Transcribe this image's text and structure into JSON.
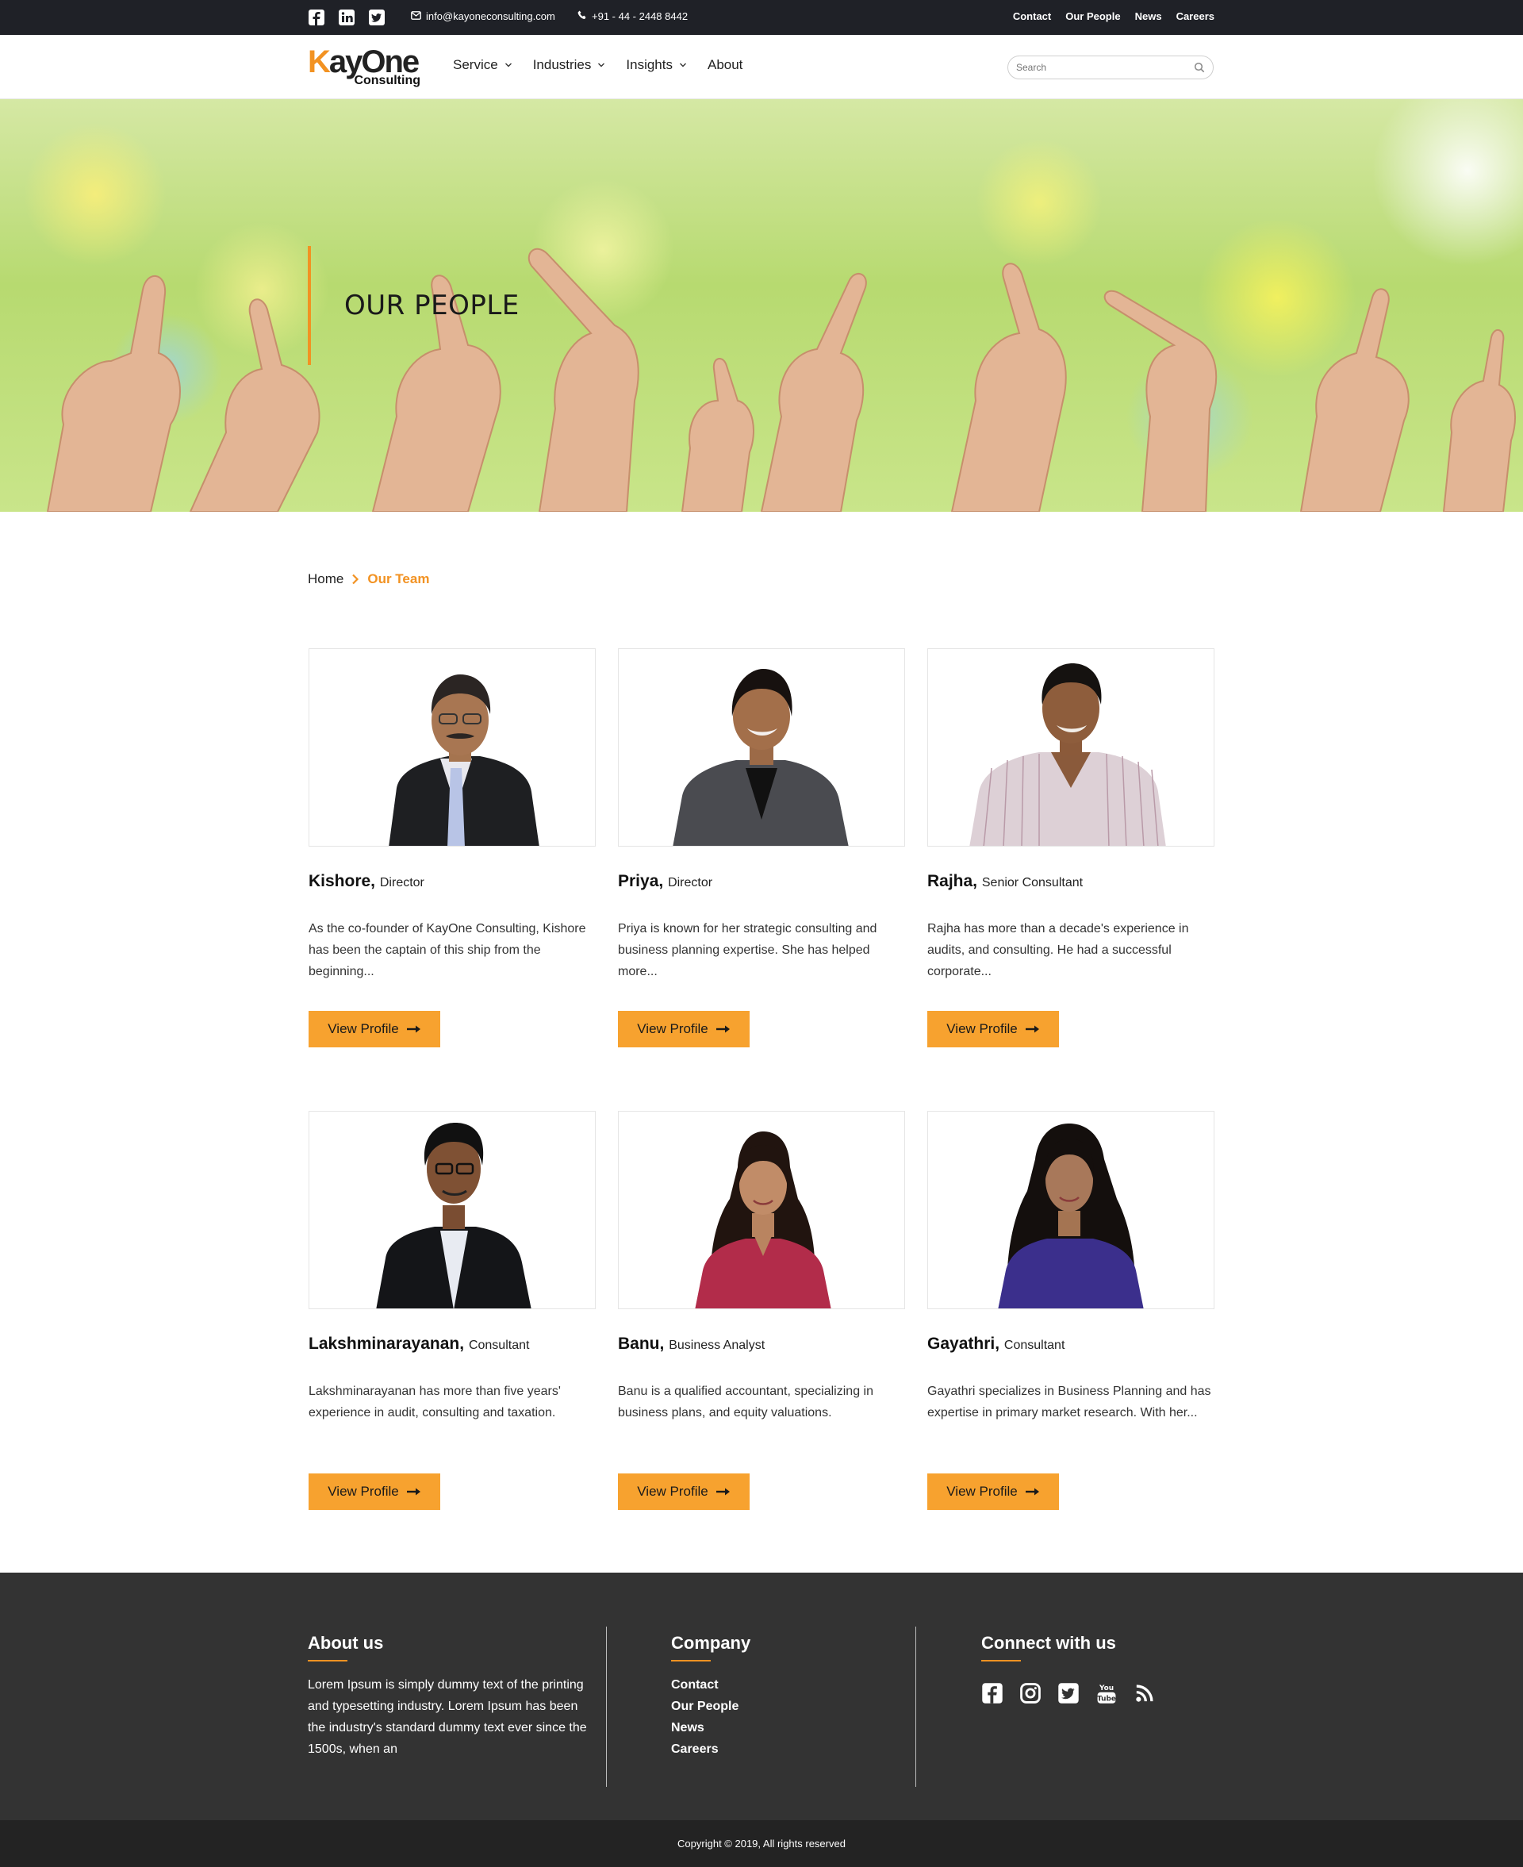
{
  "topbar": {
    "email": "info@kayoneconsulting.com",
    "phone": "+91 - 44 - 2448 8442",
    "links": [
      "Contact",
      "Our People",
      "News",
      "Careers"
    ]
  },
  "header": {
    "logo_main_first": "K",
    "logo_main_rest": "ayOne",
    "logo_sub": "Consulting",
    "nav": [
      "Service",
      "Industries",
      "Insights",
      "About"
    ],
    "search_placeholder": "Search"
  },
  "hero": {
    "title": "OUR PEOPLE"
  },
  "breadcrumb": {
    "home": "Home",
    "current": "Our Team"
  },
  "people": [
    {
      "name": "Kishore,",
      "role": "Director",
      "desc": "As the co-founder of KayOne Consulting, Kishore has been the captain of this ship from the beginning...",
      "button": "View Profile"
    },
    {
      "name": "Priya,",
      "role": "Director",
      "desc": "Priya is known for her strategic consulting and business planning expertise. She has helped more...",
      "button": "View Profile"
    },
    {
      "name": "Rajha,",
      "role": "Senior Consultant",
      "desc": "Rajha has more than a decade's experience in audits, and consulting. He had a successful corporate...",
      "button": "View Profile"
    },
    {
      "name": "Lakshminarayanan,",
      "role": "Consultant",
      "desc": "Lakshminarayanan has more than five years' experience in audit, consulting and taxation.",
      "button": "View Profile"
    },
    {
      "name": "Banu,",
      "role": "Business Analyst",
      "desc": "Banu is a qualified accountant, specializing in business plans, and equity valuations.",
      "button": "View Profile"
    },
    {
      "name": "Gayathri,",
      "role": "Consultant",
      "desc": "Gayathri specializes in Business Planning and has expertise in primary market research. With her...",
      "button": "View Profile"
    }
  ],
  "footer": {
    "about_title": "About us",
    "about_text": "Lorem Ipsum is simply dummy text of the printing and typesetting industry. Lorem Ipsum has been the industry's standard dummy text ever since the 1500s, when an",
    "company_title": "Company",
    "company_links": [
      "Contact",
      "Our People",
      "News",
      "Careers"
    ],
    "connect_title": "Connect with us",
    "copyright": "Copyright © 2019, All rights reserved"
  },
  "colors": {
    "accent": "#f29222",
    "button": "#f7a22f",
    "topbar": "#1f2127",
    "footer": "#333333",
    "copybar": "#232323"
  },
  "icons": {
    "topbar_social": [
      "facebook-icon",
      "linkedin-icon",
      "twitter-icon"
    ],
    "footer_social": [
      "facebook-icon",
      "instagram-icon",
      "twitter-icon",
      "youtube-icon",
      "rss-icon"
    ]
  }
}
